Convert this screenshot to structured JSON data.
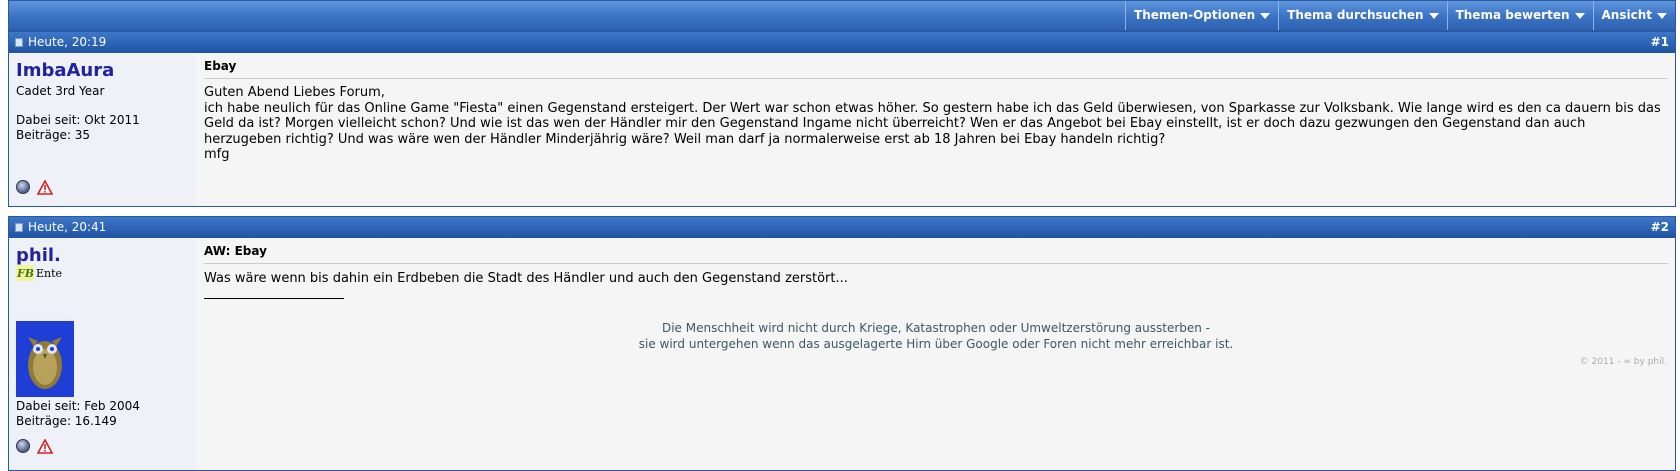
{
  "toolbar": {
    "items": [
      {
        "label": "Themen-Optionen"
      },
      {
        "label": "Thema durchsuchen"
      },
      {
        "label": "Thema bewerten"
      },
      {
        "label": "Ansicht"
      }
    ]
  },
  "posts": [
    {
      "date": "Heute, 20:19",
      "number": "#1",
      "user": {
        "name": "ImbaAura",
        "title": "Cadet 3rd Year",
        "joined": "Dabei seit: Okt 2011",
        "posts": "Beiträge: 35"
      },
      "title": "Ebay",
      "body": [
        "Guten Abend Liebes Forum,",
        "ich habe neulich für das Online Game \"Fiesta\" einen Gegenstand ersteigert. Der Wert war schon etwas höher. So gestern habe ich das Geld überwiesen, von Sparkasse zur Volksbank. Wie lange wird es den ca dauern bis das Geld da ist? Morgen vielleicht schon? Und wie ist das wen der Händler mir den Gegenstand Ingame nicht überreicht? Wen er das Angebot bei Ebay einstellt, ist er doch dazu gezwungen den Gegenstand dan auch herzugeben richtig? Und was wäre wen der Händler Minderjährig wäre? Weil man darf ja normalerweise erst ab 18 Jahren bei Ebay handeln richtig?",
        "mfg"
      ]
    },
    {
      "date": "Heute, 20:41",
      "number": "#2",
      "user": {
        "name": "phil.",
        "badge_text": "Ente",
        "joined": "Dabei seit: Feb 2004",
        "posts": "Beiträge: 16.149"
      },
      "title": "AW: Ebay",
      "body": [
        "Was wäre wenn bis dahin ein Erdbeben die Stadt des Händler und auch den Gegenstand zerstört..."
      ],
      "signature": [
        "Die Menschheit wird nicht durch Kriege, Katastrophen oder Umweltzerstörung aussterben -",
        "sie wird untergehen wenn das ausgelagerte Hirn über Google oder Foren nicht mehr erreichbar ist."
      ],
      "copyright": "© 2011 - ∞ by phil."
    }
  ],
  "colors": {
    "header_blue": "#1f53a4",
    "username": "#22229c",
    "signature": "#3a5a66"
  }
}
